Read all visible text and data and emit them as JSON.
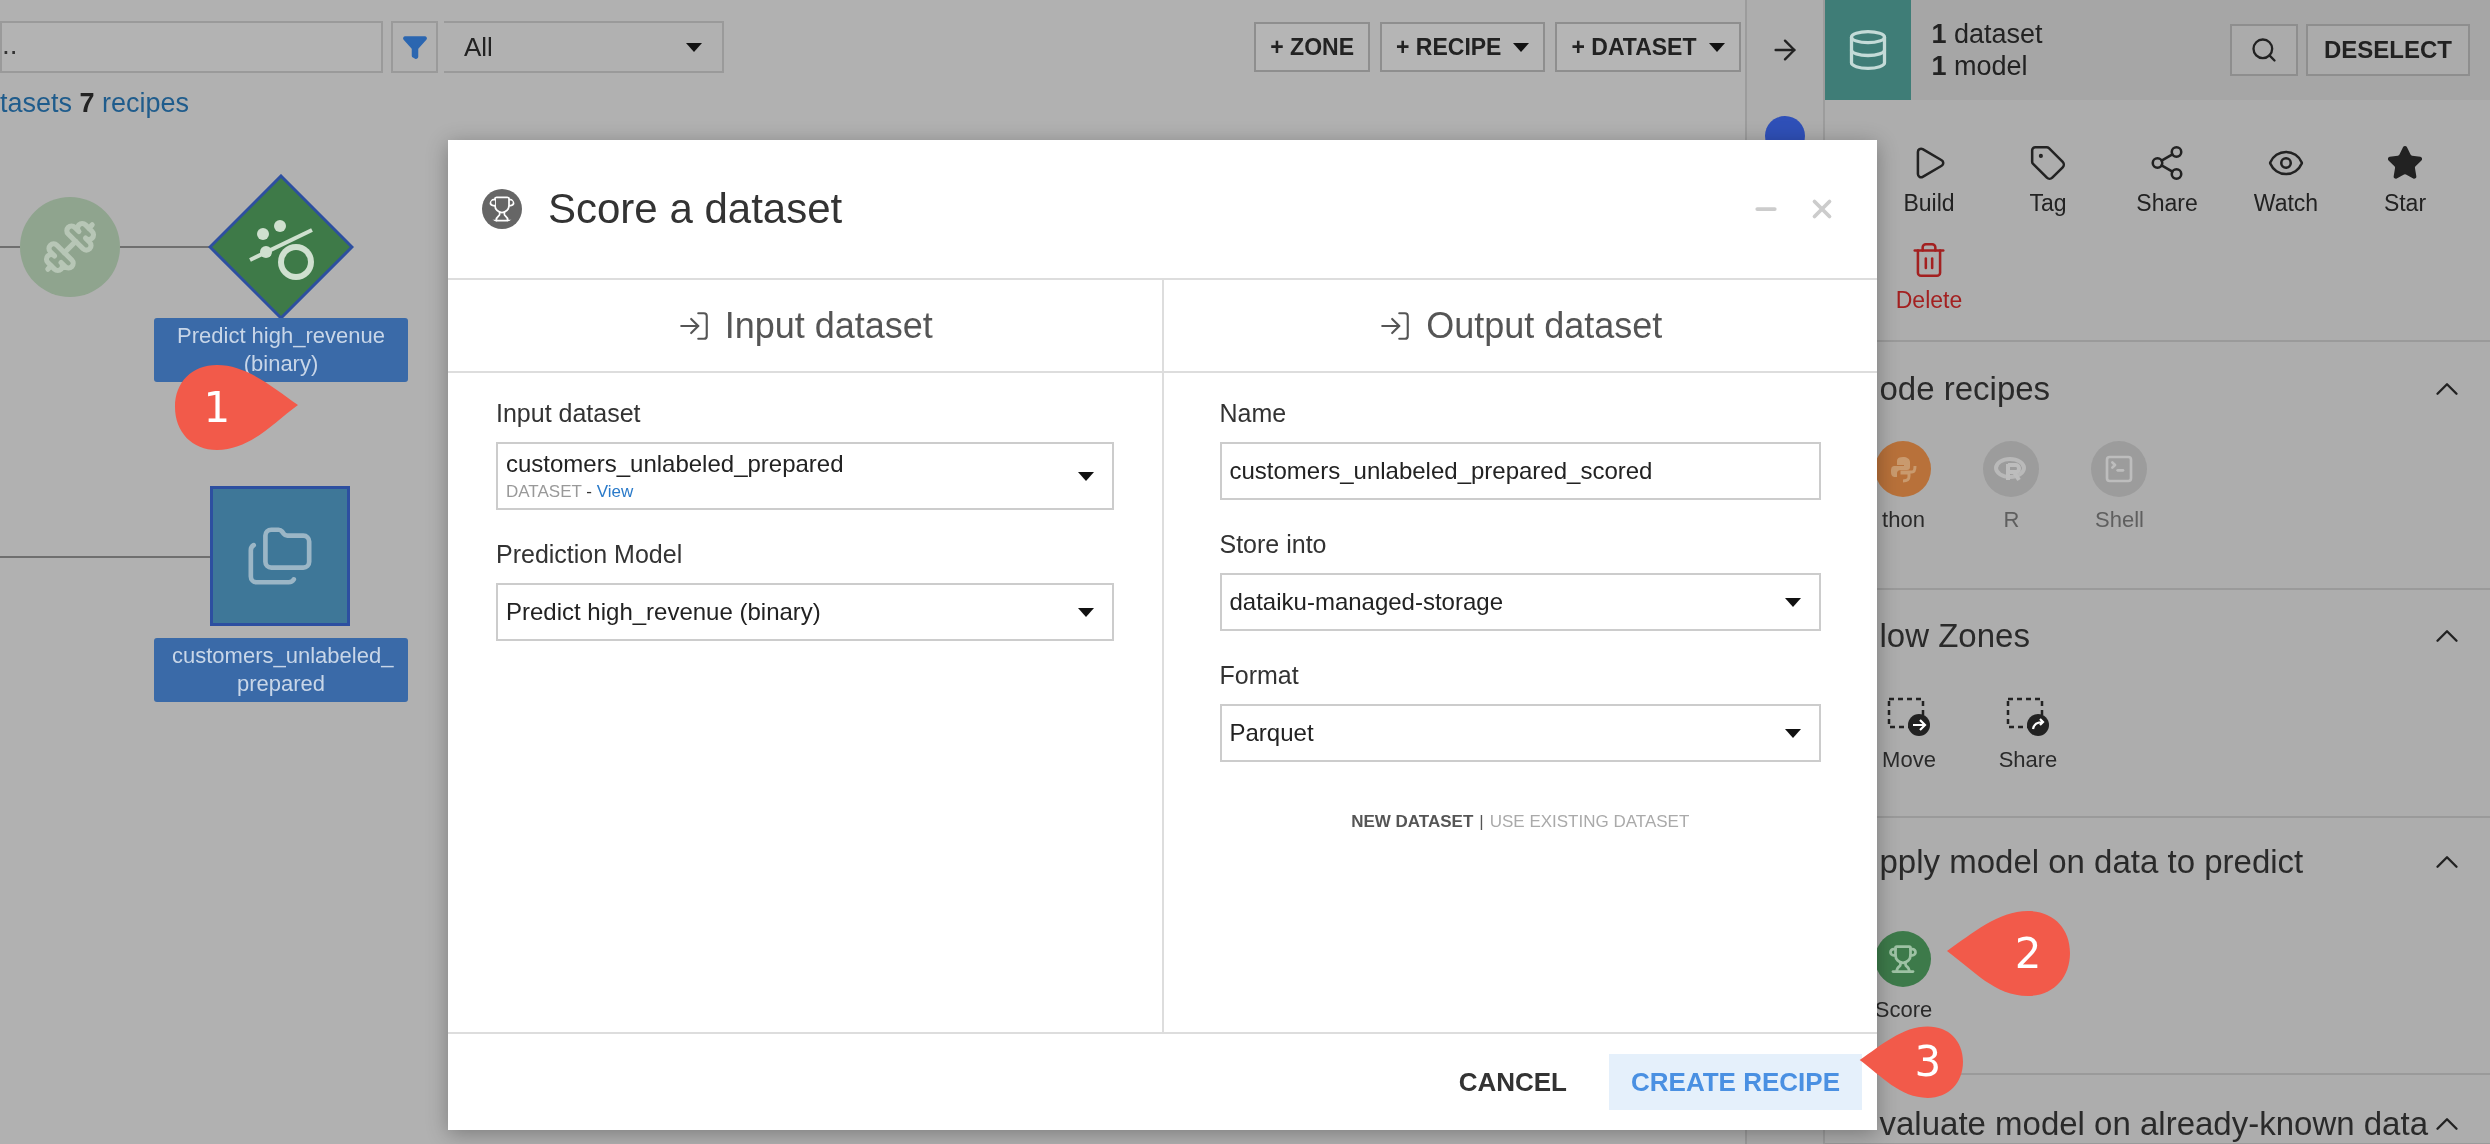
{
  "flow_toolbar": {
    "search": {
      "value": ".."
    },
    "filter": {
      "value": "All"
    },
    "buttons": [
      "+ ZONE",
      "+ RECIPE",
      "+ DATASET"
    ]
  },
  "flow_summary": "tasets **7** recipes",
  "flow_nodes": [
    {
      "kind": "recipe"
    },
    {
      "kind": "model",
      "label": "Predict high_revenue (binary)"
    },
    {
      "kind": "dataset",
      "label": "customers_unlabeled_ prepared"
    }
  ],
  "callouts": [
    {
      "number": "1",
      "kind": "right"
    },
    {
      "number": "2",
      "kind": "left"
    },
    {
      "number": "3",
      "kind": "left"
    }
  ],
  "selection_panel": {
    "summary": [
      "**1** dataset",
      "**1** model"
    ],
    "deselect": "DESELECT",
    "actions": [
      {
        "kind": "build",
        "label": "Build"
      },
      {
        "kind": "tag",
        "label": "Tag"
      },
      {
        "kind": "share",
        "label": "Share"
      },
      {
        "kind": "watch",
        "label": "Watch"
      },
      {
        "kind": "star",
        "label": "Star"
      },
      {
        "kind": "delete",
        "label": "Delete"
      }
    ],
    "sections": [
      {
        "title": "ode recipes",
        "expanded": true,
        "items": [
          {
            "kind": "python",
            "label": "thon",
            "disabled": false
          },
          {
            "kind": "r",
            "label": "R",
            "disabled": true
          },
          {
            "kind": "shell",
            "label": "Shell",
            "disabled": true
          }
        ]
      },
      {
        "title": "low Zones",
        "expanded": true,
        "items": [
          {
            "kind": "move",
            "label": "Move"
          },
          {
            "kind": "zone-share",
            "label": "Share"
          }
        ]
      },
      {
        "title": "pply model on data to predict",
        "expanded": true,
        "items": [
          {
            "kind": "score",
            "label": "Score"
          }
        ]
      },
      {
        "title": "valuate model on already-known data",
        "expanded": true
      }
    ]
  },
  "dialog": {
    "title": "Score a dataset",
    "input_column": {
      "heading": "Input dataset",
      "fields": [
        {
          "kind": "dataset-select",
          "label": "Input dataset",
          "value": "customers_unlabeled_prepared",
          "type_tag": "DATASET",
          "separator": " - ",
          "link": "View"
        },
        {
          "kind": "select",
          "label": "Prediction Model",
          "value": "Predict high_revenue (binary)"
        }
      ]
    },
    "output_column": {
      "heading": "Output dataset",
      "fields": [
        {
          "kind": "text",
          "label": "Name",
          "value": "customers_unlabeled_prepared_scored"
        },
        {
          "kind": "select",
          "label": "Store into",
          "value": "dataiku-managed-storage"
        },
        {
          "kind": "select",
          "label": "Format",
          "value": "Parquet"
        }
      ],
      "mode_options": [
        {
          "label": "NEW DATASET",
          "selected": true
        },
        {
          "label": "USE EXISTING DATASET",
          "selected": false
        }
      ],
      "mode_separator": "|"
    },
    "buttons": [
      {
        "kind": "cancel",
        "label": "CANCEL"
      },
      {
        "kind": "primary",
        "label": "CREATE RECIPE"
      }
    ]
  }
}
